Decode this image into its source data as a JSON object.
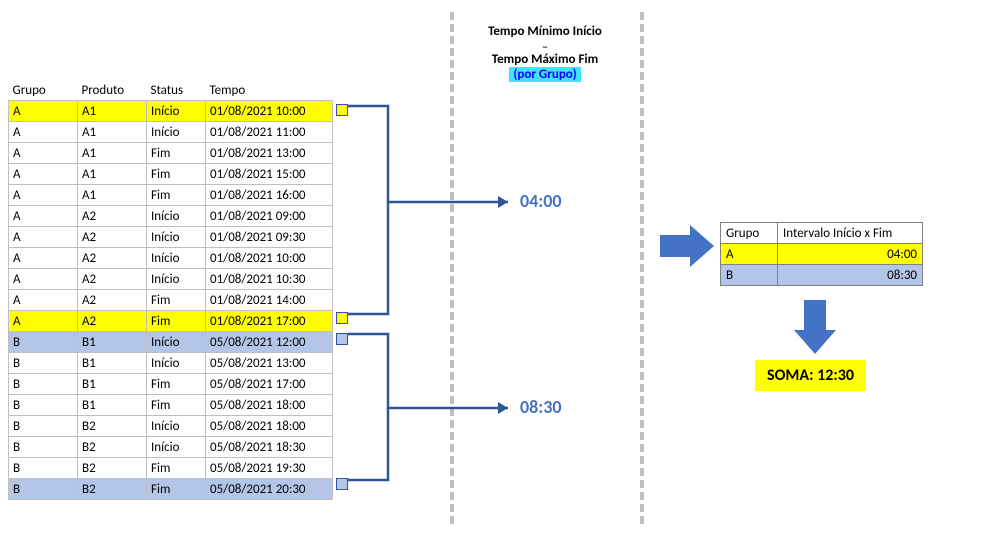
{
  "main_table": {
    "headers": [
      "Grupo",
      "Produto",
      "Status",
      "Tempo"
    ],
    "rows": [
      {
        "c": [
          "A",
          "A1",
          "Início",
          "01/08/2021 10:00"
        ],
        "hl": "yellow",
        "mark": "yellow"
      },
      {
        "c": [
          "A",
          "A1",
          "Início",
          "01/08/2021 11:00"
        ]
      },
      {
        "c": [
          "A",
          "A1",
          "Fim",
          "01/08/2021 13:00"
        ]
      },
      {
        "c": [
          "A",
          "A1",
          "Fim",
          "01/08/2021 15:00"
        ]
      },
      {
        "c": [
          "A",
          "A1",
          "Fim",
          "01/08/2021 16:00"
        ]
      },
      {
        "c": [
          "A",
          "A2",
          "Início",
          "01/08/2021 09:00"
        ]
      },
      {
        "c": [
          "A",
          "A2",
          "Início",
          "01/08/2021 09:30"
        ]
      },
      {
        "c": [
          "A",
          "A2",
          "Início",
          "01/08/2021 10:00"
        ]
      },
      {
        "c": [
          "A",
          "A2",
          "Início",
          "01/08/2021 10:30"
        ]
      },
      {
        "c": [
          "A",
          "A2",
          "Fim",
          "01/08/2021 14:00"
        ]
      },
      {
        "c": [
          "A",
          "A2",
          "Fim",
          "01/08/2021 17:00"
        ],
        "hl": "yellow",
        "mark": "yellow"
      },
      {
        "c": [
          "B",
          "B1",
          "Início",
          "05/08/2021 12:00"
        ],
        "hl": "blue",
        "mark": "blue"
      },
      {
        "c": [
          "B",
          "B1",
          "Início",
          "05/08/2021 13:00"
        ]
      },
      {
        "c": [
          "B",
          "B1",
          "Fim",
          "05/08/2021 17:00"
        ]
      },
      {
        "c": [
          "B",
          "B1",
          "Fim",
          "05/08/2021 18:00"
        ]
      },
      {
        "c": [
          "B",
          "B2",
          "Início",
          "05/08/2021 18:00"
        ]
      },
      {
        "c": [
          "B",
          "B2",
          "Início",
          "05/08/2021 18:30"
        ]
      },
      {
        "c": [
          "B",
          "B2",
          "Fim",
          "05/08/2021 19:30"
        ]
      },
      {
        "c": [
          "B",
          "B2",
          "Fim",
          "05/08/2021 20:30"
        ],
        "hl": "blue",
        "mark": "blue"
      }
    ]
  },
  "center": {
    "title1": "Tempo Mínimo Início",
    "dash": "–",
    "title2": "Tempo Máximo Fim",
    "por_grupo": "(por Grupo)",
    "value_a": "04:00",
    "value_b": "08:30"
  },
  "result_table": {
    "headers": [
      "Grupo",
      "Intervalo Início x Fim"
    ],
    "rows": [
      {
        "c": [
          "A",
          "04:00"
        ],
        "hl": "yellow"
      },
      {
        "c": [
          "B",
          "08:30"
        ],
        "hl": "blue"
      }
    ]
  },
  "soma": "SOMA: 12:30",
  "chart_data": {
    "type": "table",
    "description": "Diagram showing min-start to max-end interval per group derived from a table of timestamps.",
    "source_table_columns": [
      "Grupo",
      "Produto",
      "Status",
      "Tempo"
    ],
    "groups": [
      {
        "grupo": "A",
        "min_inicio": "01/08/2021 10:00",
        "max_fim": "01/08/2021 17:00",
        "intervalo": "04:00"
      },
      {
        "grupo": "B",
        "min_inicio": "05/08/2021 12:00",
        "max_fim": "05/08/2021 20:30",
        "intervalo": "08:30"
      }
    ],
    "sum_label": "SOMA",
    "sum_value": "12:30"
  }
}
